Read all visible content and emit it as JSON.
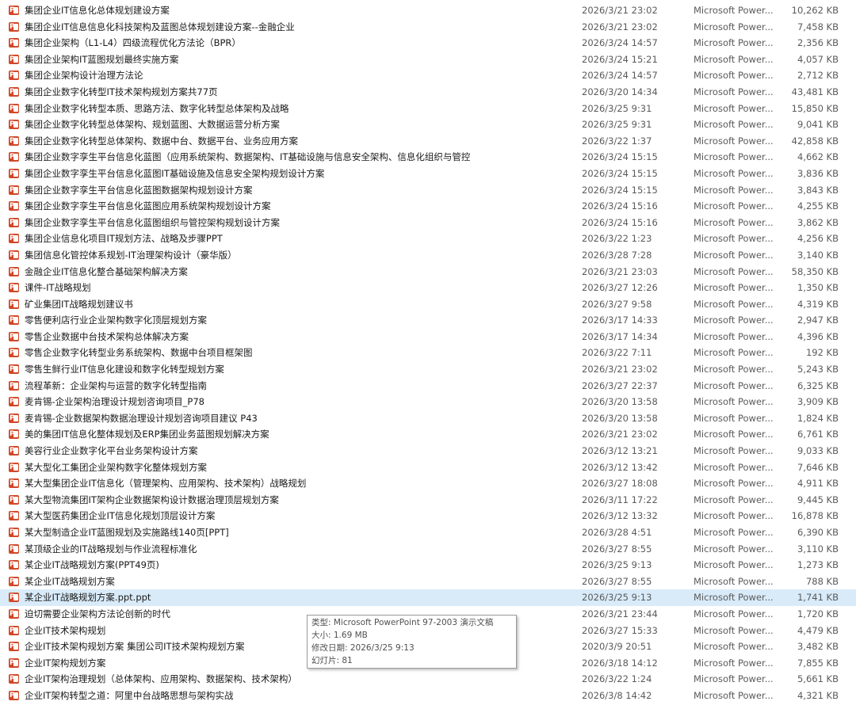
{
  "files": [
    {
      "name": "集团企业IT信息化总体规划建设方案",
      "date": "2026/3/21 23:02",
      "type": "Microsoft Power...",
      "size": "10,262 KB"
    },
    {
      "name": "集团企业IT信息信息化科技架构及蓝图总体规划建设方案--金融企业",
      "date": "2026/3/21 23:02",
      "type": "Microsoft Power...",
      "size": "7,458 KB"
    },
    {
      "name": "集团企业架构（L1-L4）四级流程优化方法论（BPR）",
      "date": "2026/3/24 14:57",
      "type": "Microsoft Power...",
      "size": "2,356 KB"
    },
    {
      "name": "集团企业架构IT蓝图规划最终实施方案",
      "date": "2026/3/24 15:21",
      "type": "Microsoft Power...",
      "size": "4,057 KB"
    },
    {
      "name": "集团企业架构设计治理方法论",
      "date": "2026/3/24 14:57",
      "type": "Microsoft Power...",
      "size": "2,712 KB"
    },
    {
      "name": "集团企业数字化转型IT技术架构规划方案共77页",
      "date": "2026/3/20 14:34",
      "type": "Microsoft Power...",
      "size": "43,481 KB"
    },
    {
      "name": "集团企业数字化转型本质、思路方法、数字化转型总体架构及战略",
      "date": "2026/3/25 9:31",
      "type": "Microsoft Power...",
      "size": "15,850 KB"
    },
    {
      "name": "集团企业数字化转型总体架构、规划蓝图、大数据运营分析方案",
      "date": "2026/3/25 9:31",
      "type": "Microsoft Power...",
      "size": "9,041 KB"
    },
    {
      "name": "集团企业数字化转型总体架构、数据中台、数据平台、业务应用方案",
      "date": "2026/3/22 1:37",
      "type": "Microsoft Power...",
      "size": "42,858 KB"
    },
    {
      "name": "集团企业数字孪生平台信息化蓝图（应用系统架构、数据架构、IT基础设施与信息安全架构、信息化组织与管控",
      "date": "2026/3/24 15:15",
      "type": "Microsoft Power...",
      "size": "4,662 KB"
    },
    {
      "name": "集团企业数字孪生平台信息化蓝图IT基础设施及信息安全架构规划设计方案",
      "date": "2026/3/24 15:15",
      "type": "Microsoft Power...",
      "size": "3,836 KB"
    },
    {
      "name": "集团企业数字孪生平台信息化蓝图数据架构规划设计方案",
      "date": "2026/3/24 15:15",
      "type": "Microsoft Power...",
      "size": "3,843 KB"
    },
    {
      "name": "集团企业数字孪生平台信息化蓝图应用系统架构规划设计方案",
      "date": "2026/3/24 15:16",
      "type": "Microsoft Power...",
      "size": "4,255 KB"
    },
    {
      "name": "集团企业数字孪生平台信息化蓝图组织与管控架构规划设计方案",
      "date": "2026/3/24 15:16",
      "type": "Microsoft Power...",
      "size": "3,862 KB"
    },
    {
      "name": "集团企业信息化项目IT规划方法、战略及步骤PPT",
      "date": "2026/3/22 1:23",
      "type": "Microsoft Power...",
      "size": "4,256 KB"
    },
    {
      "name": "集团信息化管控体系规划-IT治理架构设计（豪华版）",
      "date": "2026/3/28 7:28",
      "type": "Microsoft Power...",
      "size": "3,140 KB"
    },
    {
      "name": "金融企业IT信息化整合基础架构解决方案",
      "date": "2026/3/21 23:03",
      "type": "Microsoft Power...",
      "size": "58,350 KB"
    },
    {
      "name": "课件-IT战略规划",
      "date": "2026/3/27 12:26",
      "type": "Microsoft Power...",
      "size": "1,350 KB"
    },
    {
      "name": "矿业集团IT战略规划建议书",
      "date": "2026/3/27 9:58",
      "type": "Microsoft Power...",
      "size": "4,319 KB"
    },
    {
      "name": "零售便利店行业企业架构数字化顶层规划方案",
      "date": "2026/3/17 14:33",
      "type": "Microsoft Power...",
      "size": "2,947 KB"
    },
    {
      "name": "零售企业数据中台技术架构总体解决方案",
      "date": "2026/3/17 14:34",
      "type": "Microsoft Power...",
      "size": "4,396 KB"
    },
    {
      "name": "零售企业数字化转型业务系统架构、数据中台项目框架图",
      "date": "2026/3/22 7:11",
      "type": "Microsoft Power...",
      "size": "192 KB"
    },
    {
      "name": "零售生鲜行业IT信息化建设和数字化转型规划方案",
      "date": "2026/3/21 23:02",
      "type": "Microsoft Power...",
      "size": "5,243 KB"
    },
    {
      "name": "流程革新：企业架构与运营的数字化转型指南",
      "date": "2026/3/27 22:37",
      "type": "Microsoft Power...",
      "size": "6,325 KB"
    },
    {
      "name": "麦肯锡-企业架构治理设计规划咨询项目_P78",
      "date": "2026/3/20 13:58",
      "type": "Microsoft Power...",
      "size": "3,909 KB"
    },
    {
      "name": "麦肯锡-企业数据架构数据治理设计规划咨询项目建议 P43",
      "date": "2026/3/20 13:58",
      "type": "Microsoft Power...",
      "size": "1,824 KB"
    },
    {
      "name": "美的集团IT信息化整体规划及ERP集团业务蓝图规划解决方案",
      "date": "2026/3/21 23:02",
      "type": "Microsoft Power...",
      "size": "6,761 KB"
    },
    {
      "name": "美容行业企业数字化平台业务架构设计方案",
      "date": "2026/3/12 13:21",
      "type": "Microsoft Power...",
      "size": "9,033 KB"
    },
    {
      "name": "某大型化工集团企业架构数字化整体规划方案",
      "date": "2026/3/12 13:42",
      "type": "Microsoft Power...",
      "size": "7,646 KB"
    },
    {
      "name": "某大型集团企业IT信息化（管理架构、应用架构、技术架构）战略规划",
      "date": "2026/3/27 18:08",
      "type": "Microsoft Power...",
      "size": "4,911 KB"
    },
    {
      "name": "某大型物流集团IT架构企业数据架构设计数据治理顶层规划方案",
      "date": "2026/3/11 17:22",
      "type": "Microsoft Power...",
      "size": "9,445 KB"
    },
    {
      "name": "某大型医药集团企业IT信息化规划顶层设计方案",
      "date": "2026/3/12 13:32",
      "type": "Microsoft Power...",
      "size": "16,878 KB"
    },
    {
      "name": "某大型制造企业IT蓝图规划及实施路线140页[PPT]",
      "date": "2026/3/28 4:51",
      "type": "Microsoft Power...",
      "size": "6,390 KB"
    },
    {
      "name": "某顶级企业的IT战略规划与作业流程标准化",
      "date": "2026/3/27 8:55",
      "type": "Microsoft Power...",
      "size": "3,110 KB"
    },
    {
      "name": "某企业IT战略规划方案(PPT49页)",
      "date": "2026/3/25 9:13",
      "type": "Microsoft Power...",
      "size": "1,273 KB"
    },
    {
      "name": "某企业IT战略规划方案",
      "date": "2026/3/27 8:55",
      "type": "Microsoft Power...",
      "size": "788 KB"
    },
    {
      "name": "某企业IT战略规划方案.ppt.ppt",
      "date": "2026/3/25 9:13",
      "type": "Microsoft Power...",
      "size": "1,741 KB",
      "selected": true
    },
    {
      "name": "迫切需要企业架构方法论创新的时代",
      "date": "2026/3/21 23:44",
      "type": "Microsoft Power...",
      "size": "1,720 KB"
    },
    {
      "name": "企业IT技术架构规划",
      "date": "2026/3/27 15:33",
      "type": "Microsoft Power...",
      "size": "4,479 KB"
    },
    {
      "name": "企业IT技术架构规划方案  集团公司IT技术架构规划方案",
      "date": "2020/3/9 20:51",
      "type": "Microsoft Power...",
      "size": "3,482 KB"
    },
    {
      "name": "企业IT架构规划方案",
      "date": "2026/3/18 14:12",
      "type": "Microsoft Power...",
      "size": "7,855 KB"
    },
    {
      "name": "企业IT架构治理规划（总体架构、应用架构、数据架构、技术架构）",
      "date": "2026/3/22 1:24",
      "type": "Microsoft Power...",
      "size": "5,661 KB"
    },
    {
      "name": "企业IT架构转型之道：阿里中台战略思想与架构实战",
      "date": "2026/3/8 14:42",
      "type": "Microsoft Power...",
      "size": "4,321 KB"
    }
  ],
  "tooltip": {
    "type": "类型: Microsoft PowerPoint 97-2003 演示文稿",
    "size": "大小: 1.69 MB",
    "modified": "修改日期: 2026/3/25 9:13",
    "slides": "幻灯片: 81"
  },
  "colors": {
    "selected_row": "#d9ebf9",
    "ppt_icon": "#d24726",
    "secondary_text": "#5a5a5a"
  },
  "icon": "powerpoint-file-icon"
}
